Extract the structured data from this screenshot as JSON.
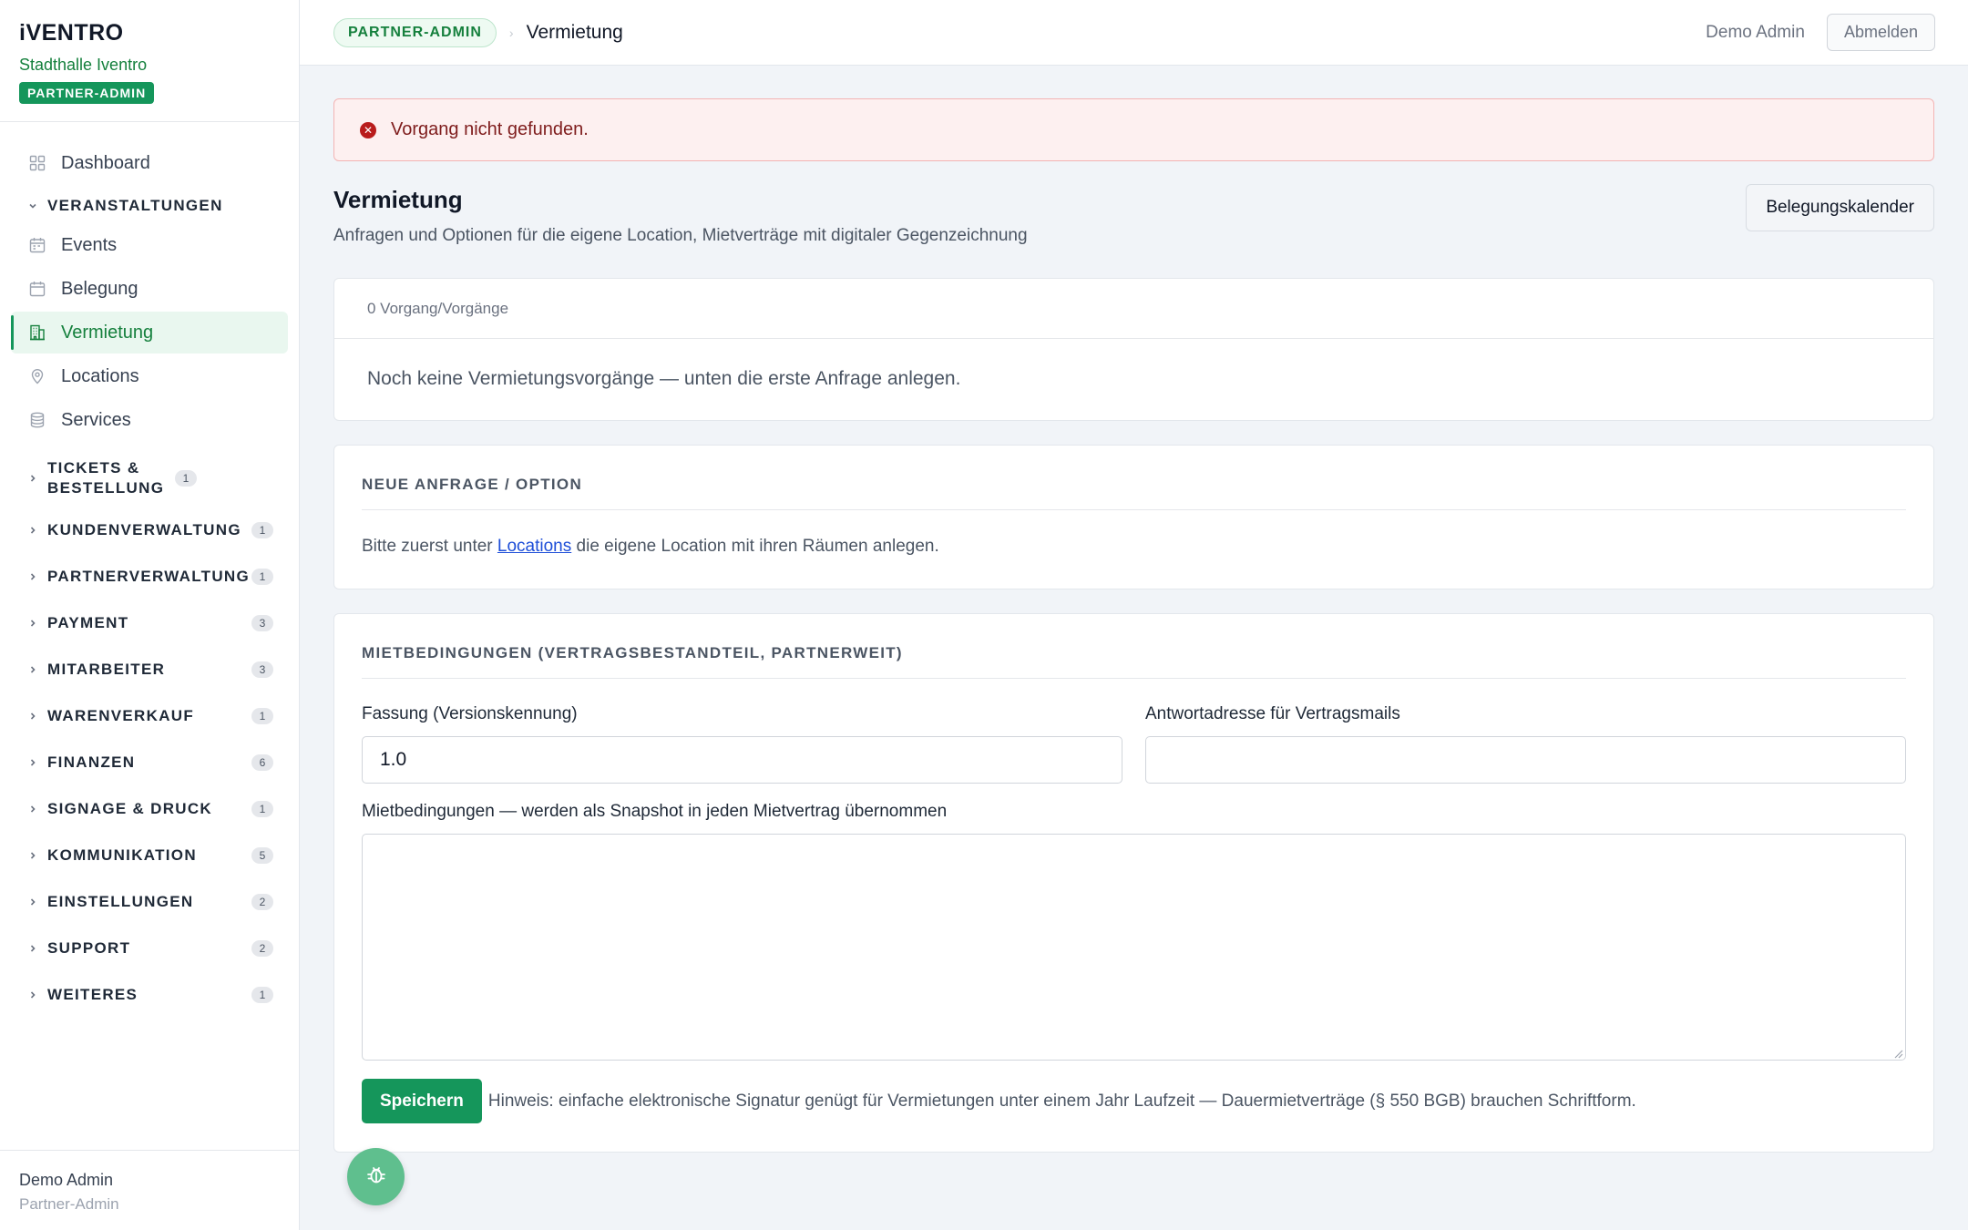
{
  "brand": {
    "logo": "iVENTRO",
    "subtitle": "Stadthalle Iventro",
    "badge": "PARTNER-ADMIN"
  },
  "sidebar": {
    "items": [
      {
        "label": "Dashboard",
        "icon": "dashboard-grid-icon"
      },
      {
        "label": "Events",
        "icon": "calendar-icon"
      },
      {
        "label": "Belegung",
        "icon": "calendar-icon"
      },
      {
        "label": "Vermietung",
        "icon": "building-icon",
        "active": true
      },
      {
        "label": "Locations",
        "icon": "map-pin-icon"
      },
      {
        "label": "Services",
        "icon": "database-icon"
      }
    ],
    "open_section": {
      "label": "VERANSTALTUNGEN"
    },
    "sections": [
      {
        "label": "TICKETS & BESTELLUNG",
        "count": "1"
      },
      {
        "label": "KUNDENVERWALTUNG",
        "count": "1"
      },
      {
        "label": "PARTNERVERWALTUNG",
        "count": "1"
      },
      {
        "label": "PAYMENT",
        "count": "3"
      },
      {
        "label": "MITARBEITER",
        "count": "3"
      },
      {
        "label": "WARENVERKAUF",
        "count": "1"
      },
      {
        "label": "FINANZEN",
        "count": "6"
      },
      {
        "label": "SIGNAGE & DRUCK",
        "count": "1"
      },
      {
        "label": "KOMMUNIKATION",
        "count": "5"
      },
      {
        "label": "EINSTELLUNGEN",
        "count": "2"
      },
      {
        "label": "SUPPORT",
        "count": "2"
      },
      {
        "label": "WEITERES",
        "count": "1"
      }
    ],
    "footer": {
      "name": "Demo Admin",
      "role": "Partner-Admin"
    }
  },
  "topbar": {
    "role_pill": "PARTNER-ADMIN",
    "separator": "›",
    "page": "Vermietung",
    "user": "Demo Admin",
    "logout": "Abmelden"
  },
  "alert": {
    "message": "Vorgang nicht gefunden."
  },
  "page": {
    "title": "Vermietung",
    "subtitle": "Anfragen und Optionen für die eigene Location, Mietverträge mit digitaler Gegenzeichnung",
    "calendar_button": "Belegungskalender"
  },
  "cases": {
    "count_text": "0 Vorgang/Vorgänge",
    "empty_text": "Noch keine Vermietungsvorgänge — unten die erste Anfrage anlegen."
  },
  "new_request": {
    "title": "NEUE ANFRAGE / OPTION",
    "text_before": "Bitte zuerst unter ",
    "link": "Locations",
    "text_after": " die eigene Location mit ihren Räumen anlegen."
  },
  "terms": {
    "title": "MIETBEDINGUNGEN (VERTRAGSBESTANDTEIL, PARTNERWEIT)",
    "version_label": "Fassung (Versionskennung)",
    "version_value": "1.0",
    "reply_label": "Antwortadresse für Vertragsmails",
    "reply_value": "",
    "terms_label": "Mietbedingungen — werden als Snapshot in jeden Mietvertrag übernommen",
    "terms_value": "",
    "save": "Speichern",
    "hint": "Hinweis: einfache elektronische Signatur genügt für Vermietungen unter einem Jahr Laufzeit — Dauermietverträge (§ 550 BGB) brauchen Schriftform."
  },
  "colors": {
    "accent": "#15965b",
    "alert_bg": "#fdf0f0",
    "alert_text": "#7f1d1d",
    "active_bg": "#e9f7ef"
  },
  "fab_icon": "bug-icon"
}
